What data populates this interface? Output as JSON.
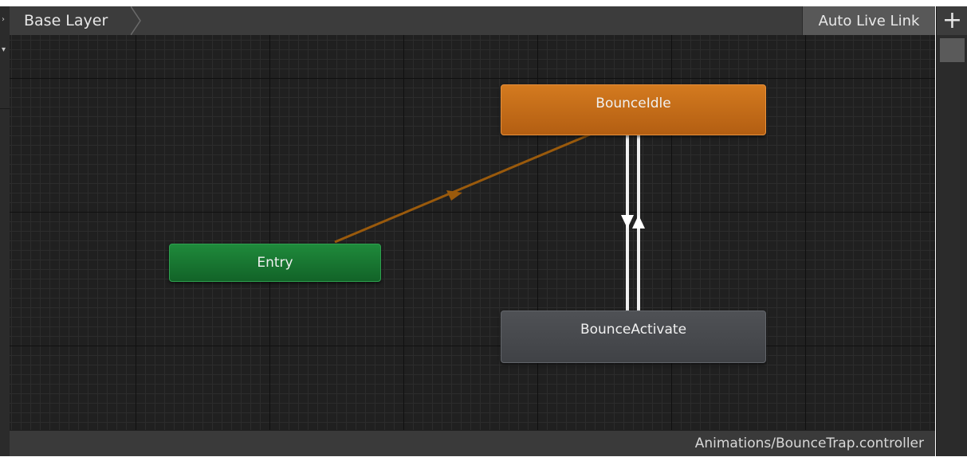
{
  "toolbar": {
    "layer_label": "Base Layer",
    "live_link_label": "Auto Live Link",
    "add_label": "+"
  },
  "graph": {
    "states": {
      "default_state": "BounceIdle",
      "entry": "Entry",
      "other": "BounceActivate"
    },
    "colors": {
      "default_state": "#c86e19",
      "entry": "#177a33",
      "state": "#47494d",
      "default_transition": "#9a5a0c",
      "transition": "#e8e8e8"
    }
  },
  "status": {
    "asset_path": "Animations/BounceTrap.controller"
  }
}
